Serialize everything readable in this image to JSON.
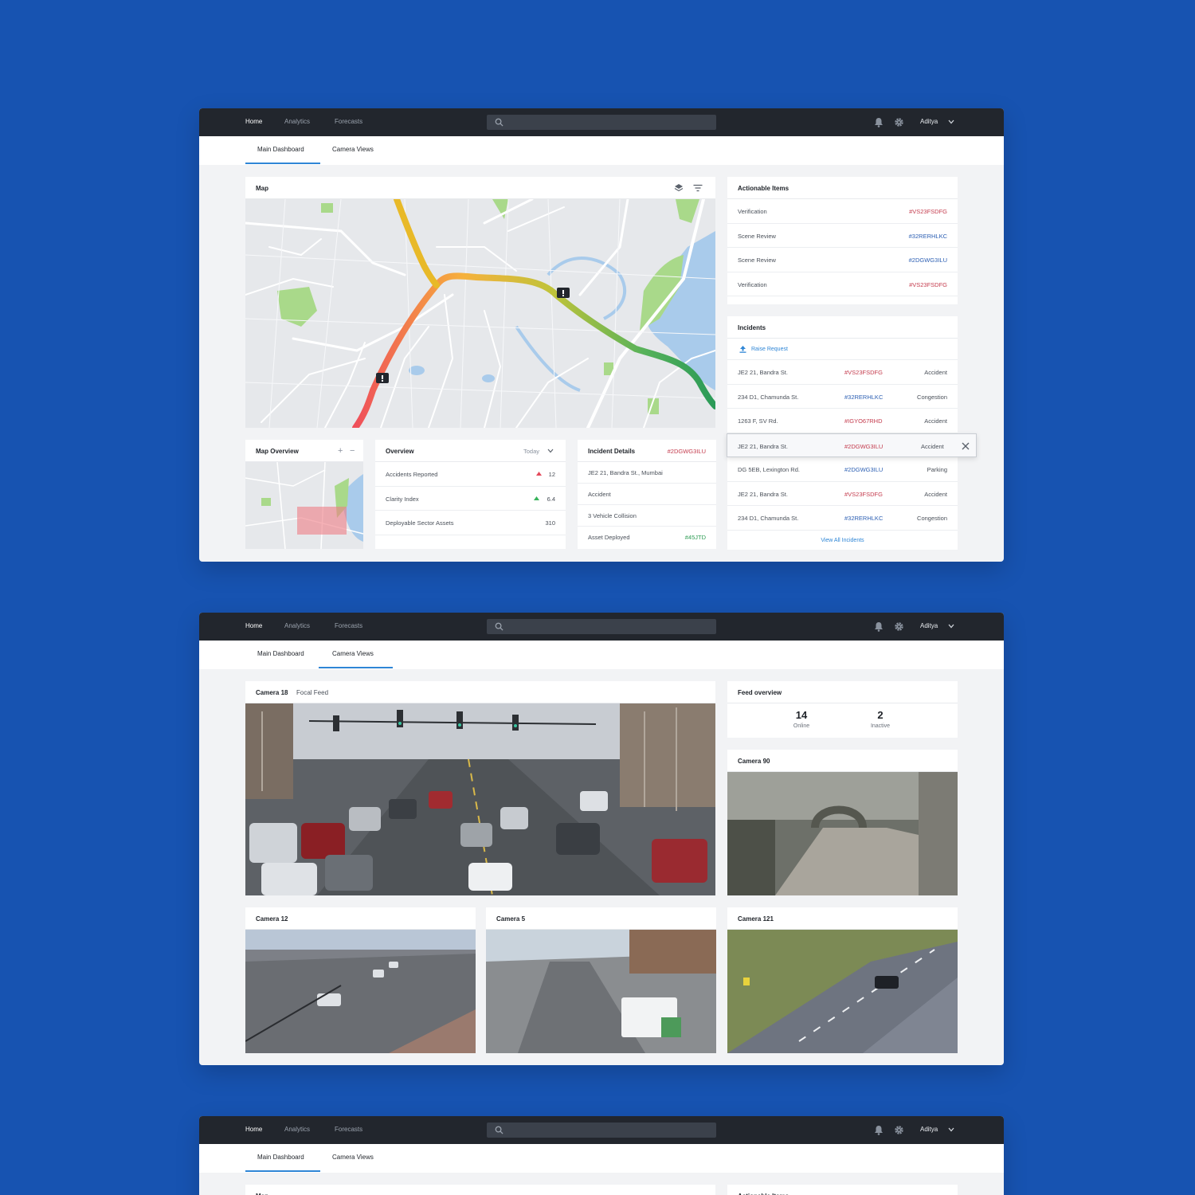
{
  "nav": {
    "home": "Home",
    "analytics": "Analytics",
    "forecasts": "Forecasts",
    "user": "Aditya"
  },
  "tabs": {
    "main": "Main Dashboard",
    "camera": "Camera Views"
  },
  "map": {
    "title": "Map"
  },
  "actionable": {
    "title": "Actionable Items",
    "items": [
      {
        "label": "Verification",
        "id": "#VS23FSDFG",
        "color": "red"
      },
      {
        "label": "Scene Review",
        "id": "#32RERHLKC",
        "color": "blue"
      },
      {
        "label": "Scene Review",
        "id": "#2DGWG3ILU",
        "color": "blue"
      },
      {
        "label": "Verification",
        "id": "#VS23FSDFG",
        "color": "red"
      }
    ]
  },
  "incidents": {
    "title": "Incidents",
    "raise": "Raise Request",
    "rows": [
      {
        "location": "JE2 21, Bandra St.",
        "id": "#VS23FSDFG",
        "type": "Accident",
        "color": "red"
      },
      {
        "location": "234 D1, Chamunda St.",
        "id": "#32RERHLKC",
        "type": "Congestion",
        "color": "blue"
      },
      {
        "location": "1263 F, SV Rd.",
        "id": "#IGYO67RHD",
        "type": "Accident",
        "color": "red"
      },
      {
        "location": "JE2 21, Bandra St.",
        "id": "#2DGWG3ILU",
        "type": "Accident",
        "color": "red"
      },
      {
        "location": "DG 5EB, Lexington Rd.",
        "id": "#2DGWG3ILU",
        "type": "Parking",
        "color": "blue"
      },
      {
        "location": "JE2 21, Bandra St.",
        "id": "#VS23FSDFG",
        "type": "Accident",
        "color": "red"
      },
      {
        "location": "234 D1, Chamunda St.",
        "id": "#32RERHLKC",
        "type": "Congestion",
        "color": "blue"
      }
    ],
    "view_all": "View All Incidents"
  },
  "map_overview": {
    "title": "Map Overview",
    "plus": "+",
    "minus": "−"
  },
  "overview": {
    "title": "Overview",
    "period": "Today",
    "rows": [
      {
        "label": "Accidents Reported",
        "value": "12",
        "trend": "up-red"
      },
      {
        "label": "Clarity Index",
        "value": "6.4",
        "trend": "up-green"
      },
      {
        "label": "Deployable Sector Assets",
        "value": "310",
        "trend": ""
      }
    ]
  },
  "incident_details": {
    "title": "Incident Details",
    "id": "#2DGWG3ILU",
    "address": "JE2 21, Bandra St., Mumbai",
    "type": "Accident",
    "description": "3 Vehicle Collision",
    "asset_label": "Asset Deployed",
    "asset_id": "#45JTD"
  },
  "camera_view": {
    "focal_camera": "Camera 18",
    "focal_label": "Focal Feed",
    "feed_overview": {
      "title": "Feed overview",
      "online_count": "14",
      "online_label": "Online",
      "inactive_count": "2",
      "inactive_label": "Inactive"
    },
    "cameras": [
      "Camera 90",
      "Camera 12",
      "Camera 5",
      "Camera 121"
    ]
  },
  "colors": {
    "background": "#1753b1",
    "navbar": "#22262d",
    "accent": "#2f86d6",
    "red_id": "#c43c4e",
    "blue_id": "#2c5fb3",
    "green": "#2f9d55"
  }
}
